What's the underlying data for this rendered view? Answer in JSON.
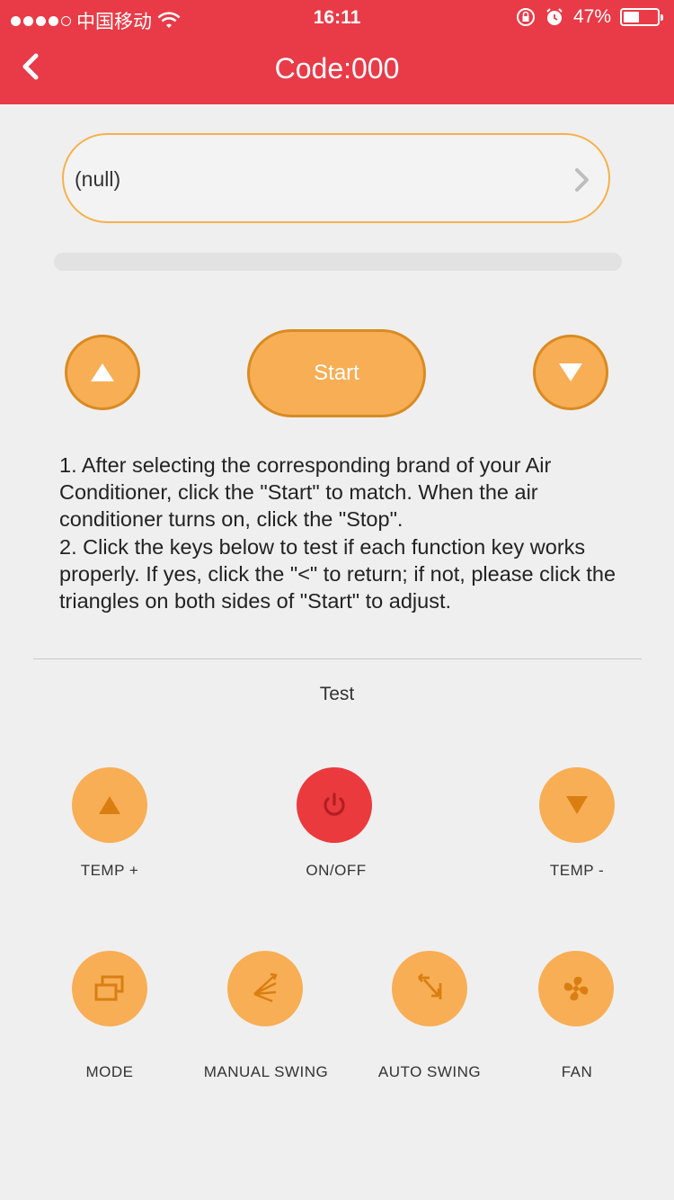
{
  "status_bar": {
    "carrier": "中国移动",
    "time": "16:11",
    "battery": "47%",
    "battery_level": 0.47
  },
  "nav": {
    "title": "Code:000"
  },
  "brand_selector": {
    "value": "(null)"
  },
  "progress": {
    "value": 0
  },
  "controls": {
    "start_label": "Start"
  },
  "instructions": {
    "line1": "1. After selecting the corresponding  brand of your Air Conditioner, click the \"Start\" to match. When the air conditioner turns on, click the \"Stop\".",
    "line2": "2. Click the keys below to test if each function key works properly. If yes, click the \"<\" to return; if not, please click the triangles on both sides of \"Start\" to adjust."
  },
  "test": {
    "title": "Test",
    "keys": {
      "temp_up": "TEMP +",
      "onoff": "ON/OFF",
      "temp_down": "TEMP -",
      "mode": "MODE",
      "manual_swing": "MANUAL SWING",
      "auto_swing": "AUTO SWING",
      "fan": "FAN"
    }
  },
  "colors": {
    "header": "#e83b47",
    "accent": "#f8ae55",
    "accent_border": "#d98b22",
    "power": "#ea3a3d"
  }
}
